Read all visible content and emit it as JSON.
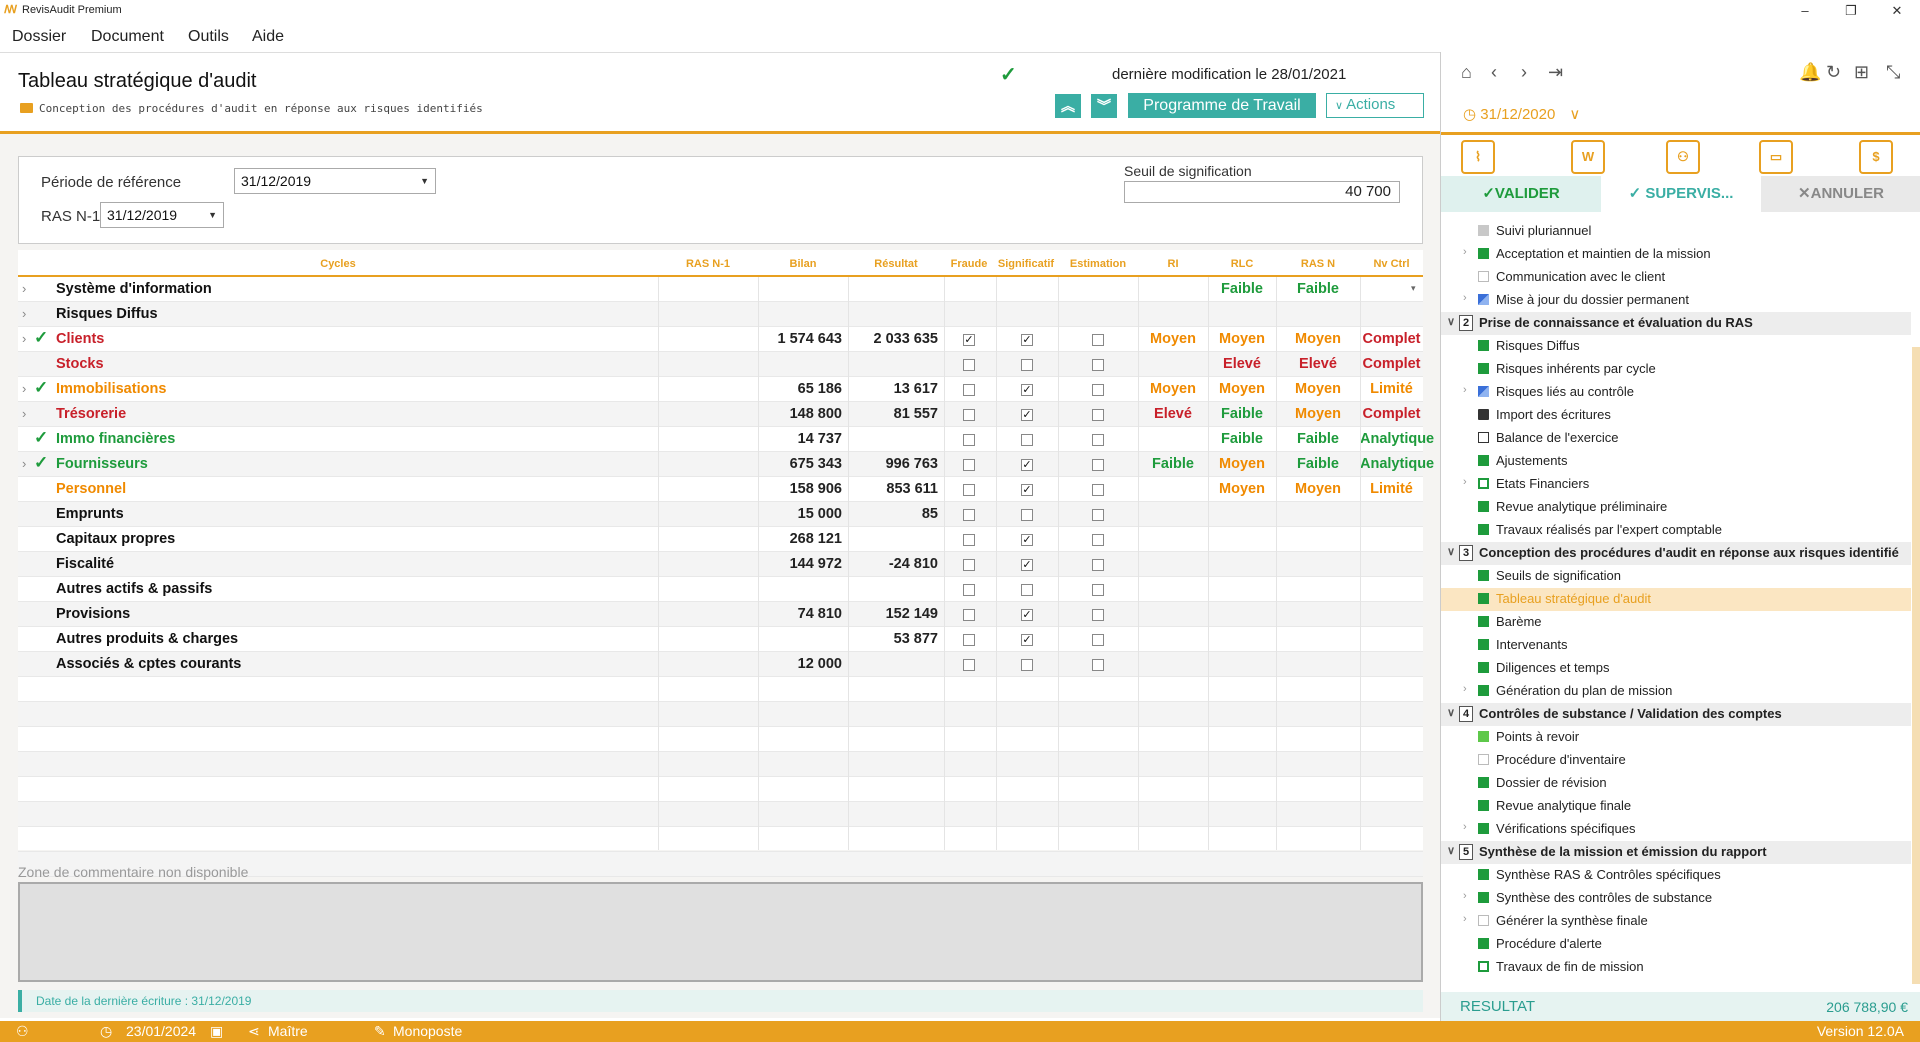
{
  "window": {
    "title": "RevisAudit Premium",
    "minimize": "–",
    "maximize": "❐",
    "close": "✕"
  },
  "menu": [
    "Dossier",
    "Document",
    "Outils",
    "Aide"
  ],
  "header": {
    "title": "Tableau stratégique d'audit",
    "subtitle": "Conception des procédures d'audit en réponse aux risques identifiés",
    "last_modified": "dernière modification le 28/01/2021",
    "programme_button": "Programme de Travail",
    "actions_button": "Actions"
  },
  "filters": {
    "periode_label": "Période de référence",
    "periode_value": "31/12/2019",
    "ras_label": "RAS N-1",
    "ras_value": "31/12/2019",
    "seuil_label": "Seuil de signification",
    "seuil_value": "40 700"
  },
  "table": {
    "headers": [
      "Cycles",
      "RAS N-1",
      "Bilan",
      "Résultat",
      "Fraude",
      "Significatif",
      "Estimation",
      "RI",
      "RLC",
      "RAS N",
      "Nv Ctrl"
    ],
    "rows": [
      {
        "cycle": "Système d'information",
        "color": "black",
        "expand": true,
        "done": false,
        "bilan": "",
        "resultat": "",
        "fraude": null,
        "signif": null,
        "estim": null,
        "ri": "",
        "rlc": "Faible",
        "rlc_c": "green",
        "rasn": "Faible",
        "rasn_c": "green",
        "nv": "",
        "nv_c": "",
        "dropdown": true
      },
      {
        "cycle": "Risques Diffus",
        "color": "black",
        "expand": true,
        "done": false,
        "bilan": "",
        "resultat": "",
        "fraude": null,
        "signif": null,
        "estim": null,
        "ri": "",
        "rlc": "",
        "rasn": "",
        "nv": ""
      },
      {
        "cycle": "Clients",
        "color": "red",
        "expand": true,
        "done": true,
        "bilan": "1 574 643",
        "resultat": "2 033 635",
        "fraude": true,
        "signif": true,
        "estim": false,
        "ri": "Moyen",
        "ri_c": "orange",
        "rlc": "Moyen",
        "rlc_c": "orange",
        "rasn": "Moyen",
        "rasn_c": "orange",
        "nv": "Complet",
        "nv_c": "red"
      },
      {
        "cycle": "Stocks",
        "color": "red",
        "expand": false,
        "done": false,
        "bilan": "",
        "resultat": "",
        "fraude": false,
        "signif": false,
        "estim": false,
        "ri": "",
        "rlc": "Elevé",
        "rlc_c": "red",
        "rasn": "Elevé",
        "rasn_c": "red",
        "nv": "Complet",
        "nv_c": "red"
      },
      {
        "cycle": "Immobilisations",
        "color": "orange",
        "expand": true,
        "done": true,
        "bilan": "65 186",
        "resultat": "13 617",
        "fraude": false,
        "signif": true,
        "estim": false,
        "ri": "Moyen",
        "ri_c": "orange",
        "rlc": "Moyen",
        "rlc_c": "orange",
        "rasn": "Moyen",
        "rasn_c": "orange",
        "nv": "Limité",
        "nv_c": "orange"
      },
      {
        "cycle": "Trésorerie",
        "color": "red",
        "expand": true,
        "done": false,
        "bilan": "148 800",
        "resultat": "81 557",
        "fraude": false,
        "signif": true,
        "estim": false,
        "ri": "Elevé",
        "ri_c": "red",
        "rlc": "Faible",
        "rlc_c": "green",
        "rasn": "Moyen",
        "rasn_c": "orange",
        "nv": "Complet",
        "nv_c": "red"
      },
      {
        "cycle": "Immo financières",
        "color": "green",
        "expand": false,
        "done": true,
        "bilan": "14 737",
        "resultat": "",
        "fraude": false,
        "signif": false,
        "estim": false,
        "ri": "",
        "rlc": "Faible",
        "rlc_c": "green",
        "rasn": "Faible",
        "rasn_c": "green",
        "nv": "Analytique",
        "nv_c": "green"
      },
      {
        "cycle": "Fournisseurs",
        "color": "green",
        "expand": true,
        "done": true,
        "bilan": "675 343",
        "resultat": "996 763",
        "fraude": false,
        "signif": true,
        "estim": false,
        "ri": "Faible",
        "ri_c": "green",
        "rlc": "Moyen",
        "rlc_c": "orange",
        "rasn": "Faible",
        "rasn_c": "green",
        "nv": "Analytique",
        "nv_c": "green"
      },
      {
        "cycle": "Personnel",
        "color": "orange",
        "expand": false,
        "done": false,
        "bilan": "158 906",
        "resultat": "853 611",
        "fraude": false,
        "signif": true,
        "estim": false,
        "ri": "",
        "rlc": "Moyen",
        "rlc_c": "orange",
        "rasn": "Moyen",
        "rasn_c": "orange",
        "nv": "Limité",
        "nv_c": "orange"
      },
      {
        "cycle": "Emprunts",
        "color": "black",
        "expand": false,
        "done": false,
        "bilan": "15 000",
        "resultat": "85",
        "fraude": false,
        "signif": false,
        "estim": false,
        "ri": "",
        "rlc": "",
        "rasn": "",
        "nv": ""
      },
      {
        "cycle": "Capitaux propres",
        "color": "black",
        "expand": false,
        "done": false,
        "bilan": "268 121",
        "resultat": "",
        "fraude": false,
        "signif": true,
        "estim": false,
        "ri": "",
        "rlc": "",
        "rasn": "",
        "nv": ""
      },
      {
        "cycle": "Fiscalité",
        "color": "black",
        "expand": false,
        "done": false,
        "bilan": "144 972",
        "resultat": "-24 810",
        "fraude": false,
        "signif": true,
        "estim": false,
        "ri": "",
        "rlc": "",
        "rasn": "",
        "nv": ""
      },
      {
        "cycle": "Autres actifs & passifs",
        "color": "black",
        "expand": false,
        "done": false,
        "bilan": "",
        "resultat": "",
        "fraude": false,
        "signif": false,
        "estim": false,
        "ri": "",
        "rlc": "",
        "rasn": "",
        "nv": ""
      },
      {
        "cycle": "Provisions",
        "color": "black",
        "expand": false,
        "done": false,
        "bilan": "74 810",
        "resultat": "152 149",
        "fraude": false,
        "signif": true,
        "estim": false,
        "ri": "",
        "rlc": "",
        "rasn": "",
        "nv": ""
      },
      {
        "cycle": "Autres produits & charges",
        "color": "black",
        "expand": false,
        "done": false,
        "bilan": "",
        "resultat": "53 877",
        "fraude": false,
        "signif": true,
        "estim": false,
        "ri": "",
        "rlc": "",
        "rasn": "",
        "nv": ""
      },
      {
        "cycle": "Associés & cptes courants",
        "color": "black",
        "expand": false,
        "done": false,
        "bilan": "12 000",
        "resultat": "",
        "fraude": false,
        "signif": false,
        "estim": false,
        "ri": "",
        "rlc": "",
        "rasn": "",
        "nv": ""
      }
    ]
  },
  "comment": {
    "label": "Zone de commentaire non disponible",
    "last_entry": "Date de la dernière écriture : 31/12/2019"
  },
  "right_panel": {
    "date": "31/12/2020",
    "validate": "VALIDER",
    "supervise": "SUPERVIS...",
    "cancel": "ANNULER",
    "resultat_label": "RESULTAT",
    "resultat_value": "206 788,90 €",
    "tree": [
      {
        "type": "item",
        "label": "Suivi pluriannuel",
        "sq": "grey",
        "ex": false
      },
      {
        "type": "item",
        "label": "Acceptation et maintien de la mission",
        "sq": "green",
        "ex": true
      },
      {
        "type": "item",
        "label": "Communication avec le client",
        "sq": "empty-grey",
        "ex": false
      },
      {
        "type": "item",
        "label": "Mise à jour du dossier permanent",
        "sq": "blue-half",
        "ex": true
      },
      {
        "type": "section",
        "n": "2",
        "label": "Prise de connaissance et évaluation du RAS"
      },
      {
        "type": "item",
        "label": "Risques Diffus",
        "sq": "green-half",
        "ex": false
      },
      {
        "type": "item",
        "label": "Risques inhérents par cycle",
        "sq": "green-half",
        "ex": false
      },
      {
        "type": "item",
        "label": "Risques liés au contrôle",
        "sq": "blue-half",
        "ex": true
      },
      {
        "type": "item",
        "label": "Import des écritures",
        "sq": "doc",
        "ex": false
      },
      {
        "type": "item",
        "label": "Balance de l'exercice",
        "sq": "scale",
        "ex": false
      },
      {
        "type": "item",
        "label": "Ajustements",
        "sq": "green",
        "ex": false
      },
      {
        "type": "item",
        "label": "Etats Financiers",
        "sq": "empty-green",
        "ex": true
      },
      {
        "type": "item",
        "label": "Revue analytique préliminaire",
        "sq": "green-half",
        "ex": false
      },
      {
        "type": "item",
        "label": "Travaux réalisés par l'expert comptable",
        "sq": "green",
        "ex": false
      },
      {
        "type": "section",
        "n": "3",
        "label": "Conception des procédures d'audit en réponse aux risques identifié"
      },
      {
        "type": "item",
        "label": "Seuils de signification",
        "sq": "green",
        "ex": false
      },
      {
        "type": "item",
        "label": "Tableau stratégique d'audit",
        "sq": "green",
        "ex": false,
        "selected": true
      },
      {
        "type": "item",
        "label": "Barème",
        "sq": "green",
        "ex": false
      },
      {
        "type": "item",
        "label": "Intervenants",
        "sq": "green",
        "ex": false
      },
      {
        "type": "item",
        "label": "Diligences et temps",
        "sq": "green",
        "ex": false
      },
      {
        "type": "item",
        "label": "Génération du plan de mission",
        "sq": "green",
        "ex": true
      },
      {
        "type": "section",
        "n": "4",
        "label": "Contrôles de substance / Validation des comptes"
      },
      {
        "type": "item",
        "label": "Points à revoir",
        "sq": "lightgreen",
        "ex": false
      },
      {
        "type": "item",
        "label": "Procédure d'inventaire",
        "sq": "empty-grey",
        "ex": false
      },
      {
        "type": "item",
        "label": "Dossier de révision",
        "sq": "green-half",
        "ex": false
      },
      {
        "type": "item",
        "label": "Revue analytique finale",
        "sq": "green-half",
        "ex": false
      },
      {
        "type": "item",
        "label": "Vérifications spécifiques",
        "sq": "green-half",
        "ex": true
      },
      {
        "type": "section",
        "n": "5",
        "label": "Synthèse de la mission et émission du rapport"
      },
      {
        "type": "item",
        "label": "Synthèse RAS & Contrôles spécifiques",
        "sq": "green-half",
        "ex": false
      },
      {
        "type": "item",
        "label": "Synthèse des contrôles de substance",
        "sq": "green-half",
        "ex": true
      },
      {
        "type": "item",
        "label": "Générer la synthèse finale",
        "sq": "empty-grey",
        "ex": true
      },
      {
        "type": "item",
        "label": "Procédure d'alerte",
        "sq": "green",
        "ex": false
      },
      {
        "type": "item",
        "label": "Travaux de fin de mission",
        "sq": "empty-green",
        "ex": false
      }
    ]
  },
  "status": {
    "date": "23/01/2024",
    "user": "Maître",
    "mode": "Monoposte",
    "version": "Version 12.0A"
  },
  "colors": {
    "accent": "#e8a020",
    "teal": "#3aaea4",
    "green": "#1e9b3c",
    "red": "#c8202a",
    "orange": "#f08a00"
  }
}
